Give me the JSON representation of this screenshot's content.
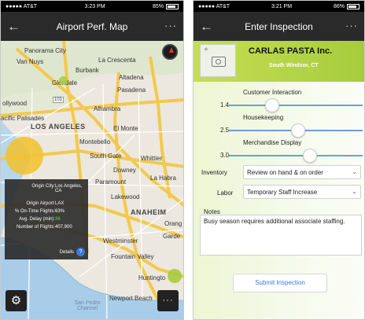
{
  "left": {
    "status": {
      "carrier": "●●●●● AT&T",
      "time": "3:23 PM",
      "battery": "85%"
    },
    "nav": {
      "title": "Airport Perf. Map",
      "back": "←",
      "more": "···"
    },
    "map_labels": {
      "panorama": "Panorama City",
      "van_nuys": "Van Nuys",
      "la_crescenta": "La Crescenta",
      "burbank": "Burbank",
      "altadena": "Altadena",
      "glendale": "Glendale",
      "pasadena": "Pasadena",
      "hollywood": "ollywood",
      "r101": "101",
      "alhambra": "Alhambra",
      "pacific": "acific Palisades",
      "los_angeles": "LOS ANGELES",
      "el_monte": "El Monte",
      "montebello": "Montebello",
      "south_gate": "South Gate",
      "whittier": "Whittier",
      "downey": "Downey",
      "paramount": "Paramount",
      "la_habra": "La Habra",
      "lakewood": "Lakewood",
      "anaheim": "ANAHEIM",
      "orange": "Orang",
      "westminster": "Westminster",
      "garden": "Garde",
      "fountain_valley": "Fountain Valley",
      "huntington": "Huntingto",
      "newport": "Newport Beach",
      "san_pedro": "San Pedro Channel"
    },
    "popup": {
      "origin_city_label": "Origin City:",
      "origin_city_value": "Los Angeles, CA",
      "origin_airport_label": "Origin Airport:",
      "origin_airport_value": "LAX",
      "ontime_label": "% On-Time Flights:",
      "ontime_value": "63%",
      "delay_label": "Avg. Delay (min):",
      "delay_value": "36",
      "flights_label": "Number of Flights:",
      "flights_value": "407,900",
      "details": "Details",
      "details_icon": "?"
    },
    "settings_icon": "gear-icon",
    "menu_label": "···",
    "colors": {
      "bubble_yellow": "#f3c12b",
      "bubble_green": "#a6cc3e",
      "delay_green": "#6fcf3a"
    }
  },
  "right": {
    "status": {
      "carrier": "●●●●● AT&T",
      "time": "3:21 PM",
      "battery": "86%"
    },
    "nav": {
      "title": "Enter Inspection",
      "back": "←",
      "more": "···"
    },
    "company": {
      "name": "CARLAS PASTA Inc.",
      "location": "South Windsor, CT"
    },
    "sliders": [
      {
        "label": "Customer Interaction",
        "value": "1.4",
        "fraction": 0.28
      },
      {
        "label": "Housekeeping",
        "value": "2.5",
        "fraction": 0.5
      },
      {
        "label": "Merchandise Display",
        "value": "3.0",
        "fraction": 0.6
      }
    ],
    "inventory": {
      "label": "Inventory",
      "value": "Review on hand & on order"
    },
    "labor": {
      "label": "Labor",
      "value": "Temporary Staff Increase"
    },
    "notes": {
      "label": "Notes",
      "value": "Busy season requires additional associate staffing."
    },
    "submit": "Submit Inspection",
    "colors": {
      "accent": "#a6cc3e",
      "link": "#3a7be0"
    }
  }
}
